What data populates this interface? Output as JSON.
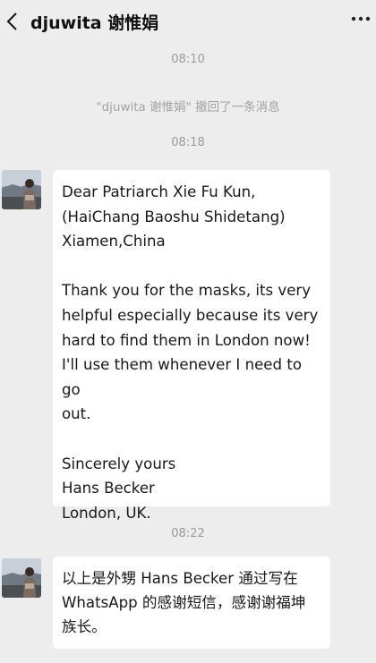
{
  "header": {
    "title": "djuwita 谢惟娟",
    "back_icon": "chevron-left-icon",
    "more_icon": "more-dots-icon"
  },
  "conversation": {
    "timestamps": [
      "08:10",
      "08:18",
      "08:22"
    ],
    "system_note": "\"djuwita 谢惟娟\" 撤回了一条消息",
    "messages": [
      {
        "paragraphs": [
          "Dear Patriarch Xie Fu Kun,\n(HaiChang Baoshu Shidetang)\nXiamen,China",
          "Thank you for the masks, its very\nhelpful especially because its very\nhard to find them in London now!\nI'll use them whenever I need to go\nout.",
          "Sincerely yours\nHans Becker\nLondon, UK."
        ]
      },
      {
        "text": "以上是外甥 Hans Becker 通过写在\nWhatsApp 的感谢短信，感谢谢福坤\n族长。"
      }
    ]
  },
  "colors": {
    "background": "#ededed",
    "bubble": "#ffffff",
    "meta_text": "#9a9a9a"
  }
}
